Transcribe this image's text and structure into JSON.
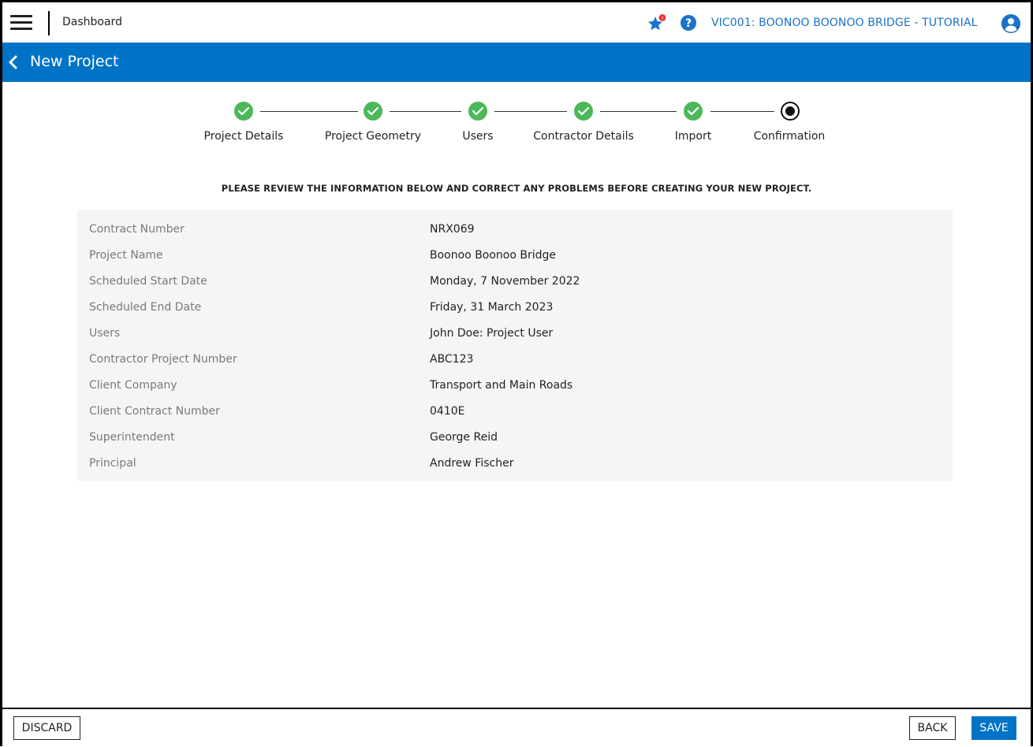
{
  "topbar": {
    "dashboard_label": "Dashboard",
    "project_link": "VIC001: BOONOO BOONOO BRIDGE - TUTORIAL",
    "notification_badge": "!",
    "icons": {
      "menu": "hamburger-menu-icon",
      "favorites": "star-icon",
      "help": "help-icon",
      "account": "user-account-icon"
    }
  },
  "header": {
    "title": "New Project",
    "back_icon": "chevron-left-icon"
  },
  "stepper": {
    "steps": [
      {
        "label": "Project Details",
        "status": "complete"
      },
      {
        "label": "Project Geometry",
        "status": "complete"
      },
      {
        "label": "Users",
        "status": "complete"
      },
      {
        "label": "Contractor Details",
        "status": "complete"
      },
      {
        "label": "Import",
        "status": "complete"
      },
      {
        "label": "Confirmation",
        "status": "current"
      }
    ]
  },
  "instruction": "PLEASE REVIEW THE INFORMATION BELOW AND CORRECT ANY PROBLEMS BEFORE CREATING YOUR NEW PROJECT.",
  "summary": [
    {
      "label": "Contract Number",
      "value": "NRX069"
    },
    {
      "label": "Project Name",
      "value": "Boonoo Boonoo Bridge"
    },
    {
      "label": "Scheduled Start Date",
      "value": "Monday, 7 November 2022"
    },
    {
      "label": "Scheduled End Date",
      "value": "Friday, 31 March 2023"
    },
    {
      "label": "Users",
      "value": "John Doe: Project User"
    },
    {
      "label": "Contractor Project Number",
      "value": "ABC123"
    },
    {
      "label": "Client Company",
      "value": "Transport and Main Roads"
    },
    {
      "label": "Client Contract Number",
      "value": "0410E"
    },
    {
      "label": "Superintendent",
      "value": "George Reid"
    },
    {
      "label": "Principal",
      "value": "Andrew Fischer"
    }
  ],
  "footer": {
    "discard_label": "DISCARD",
    "back_label": "BACK",
    "save_label": "SAVE"
  },
  "colors": {
    "primary": "#0073c6",
    "step_complete": "#4cb85a",
    "link": "#1a72c9",
    "badge": "#e53935"
  }
}
